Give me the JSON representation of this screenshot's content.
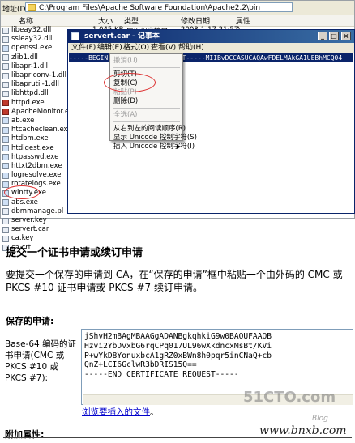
{
  "explorer": {
    "address_label": "地址(D)",
    "address_path": "C:\\Program Files\\Apache Software Foundation\\Apache2.2\\bin",
    "columns": [
      "名称",
      "大小",
      "类型",
      "修改日期",
      "属性"
    ],
    "files": [
      {
        "name": "libeay32.dll",
        "type": "dll"
      },
      {
        "name": "ssleay32.dll",
        "type": "dll"
      },
      {
        "name": "openssl.exe",
        "type": "exe"
      },
      {
        "name": "zlib1.dll",
        "type": "dll"
      },
      {
        "name": "libapr-1.dll",
        "type": "dll"
      },
      {
        "name": "libapriconv-1.dll",
        "type": "dll"
      },
      {
        "name": "libaprutil-1.dll",
        "type": "dll"
      },
      {
        "name": "libhttpd.dll",
        "type": "dll"
      },
      {
        "name": "httpd.exe",
        "type": "feather"
      },
      {
        "name": "ApacheMonitor.exe",
        "type": "feather"
      },
      {
        "name": "ab.exe",
        "type": "exe"
      },
      {
        "name": "htcacheclean.exe",
        "type": "exe"
      },
      {
        "name": "htdbm.exe",
        "type": "exe"
      },
      {
        "name": "htdigest.exe",
        "type": "exe"
      },
      {
        "name": "htpasswd.exe",
        "type": "exe"
      },
      {
        "name": "httxt2dbm.exe",
        "type": "exe"
      },
      {
        "name": "logresolve.exe",
        "type": "exe"
      },
      {
        "name": "rotatelogs.exe",
        "type": "exe"
      },
      {
        "name": "wintty.exe",
        "type": "exe"
      },
      {
        "name": "abs.exe",
        "type": "exe"
      },
      {
        "name": "dbmmanage.pl",
        "type": "file"
      },
      {
        "name": "server.key",
        "type": "file"
      },
      {
        "name": "servert.car",
        "type": "file"
      },
      {
        "name": "ca.key",
        "type": "file"
      },
      {
        "name": "ca.crt",
        "type": "file"
      }
    ],
    "first_row_size": "1,045 KB",
    "first_row_type": "应用程序扩展",
    "first_row_date": "2008-1-17 21:57",
    "first_row_attr": "A"
  },
  "notepad": {
    "title": "servert.car - 记事本",
    "menus": [
      "文件(F)",
      "编辑(E)",
      "格式(O)",
      "查看(V)",
      "帮助(H)"
    ],
    "selected_line": "-----BEGIN CERTIFICATE REQUEST-----MIIBvDCCASUCAQAwFDELMAkGA1UEBhMCQ04"
  },
  "context_menu": {
    "items": [
      {
        "label": "撤消(U)",
        "disabled": true
      },
      {
        "sep": true
      },
      {
        "label": "剪切(T)",
        "disabled": false
      },
      {
        "label": "复制(C)",
        "disabled": false
      },
      {
        "label": "粘贴(P)",
        "disabled": true
      },
      {
        "label": "删除(D)",
        "disabled": false
      },
      {
        "sep": true
      },
      {
        "label": "全选(A)",
        "disabled": true
      },
      {
        "sep": true
      },
      {
        "label": "从右到左的阅读顺序(R)",
        "disabled": false
      },
      {
        "label": "显示 Unicode 控制字符(S)",
        "disabled": false
      },
      {
        "label": "插入 Unicode 控制字符(I)",
        "disabled": false,
        "submenu": true
      }
    ]
  },
  "web": {
    "title": "提交一个证书申请或续订申请",
    "intro": "要提交一个保存的申请到 CA，在“保存的申请”框中粘贴一个由外码的 CMC 或 PKCS #10 证书申请或 PKCS #7 续订申请。",
    "saved_label": "保存的申请:",
    "field_label": "Base-64 编码的证书申请(CMC 或PKCS #10 或PKCS #7):",
    "request_lines": [
      "jShvH2mBAgMBAAGgADANBgkqhkiG9w0BAQUFAAOB",
      "Hzvi2YbDvxbG6rqCPq017UL96wXkdncxMsBt/KVi",
      "P+wYkD8YonuxbcA1gRZ0xBWn8h0pqr5inCNaQ+cb",
      "QnZ+LCI6GclwR3bDRIS15Q==",
      "-----END CERTIFICATE REQUEST-----"
    ],
    "browse_link": "浏览要插入的文件",
    "browse_suffix": "。",
    "extra_label": "附加属性:"
  },
  "watermark": {
    "text": "51CTO.com",
    "blog": "Blog",
    "site": "www.bnxb.com"
  },
  "colors": {
    "title_bar": "#0a246a",
    "link": "#0000cc",
    "circle": "#dd3333"
  }
}
